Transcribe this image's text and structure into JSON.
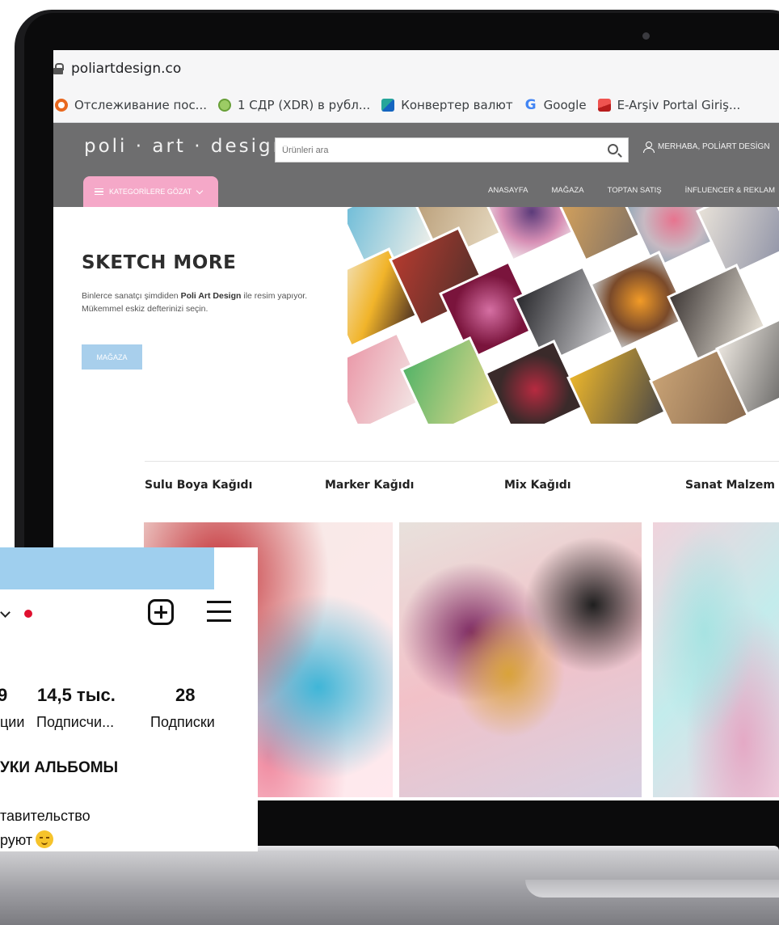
{
  "browser": {
    "url": "poliartdesign.co",
    "bookmarks": [
      {
        "label": "Отслеживание пос...",
        "icon": "tracking-icon",
        "color": "#e9681f"
      },
      {
        "label": "1 СДР (XDR) в рубл...",
        "icon": "xdr-icon",
        "color": "#7cb342"
      },
      {
        "label": "Конвертер валют",
        "icon": "currency-icon",
        "color": "#1e88a8"
      },
      {
        "label": "Google",
        "icon": "google-icon",
        "color": "#4285f4"
      },
      {
        "label": "E-Arşiv Portal Giriş...",
        "icon": "earsiv-icon",
        "color": "#c62828"
      }
    ]
  },
  "site": {
    "logo": "poli · art · design",
    "search_placeholder": "Ürünleri ara",
    "user_label": "MERHABA, POLİART DESİGN",
    "categories_button": "KATEGORİLERE GÖZAT",
    "nav": [
      "ANASAYFA",
      "MAĞAZA",
      "TOPTAN SATIŞ",
      "İNFLUENCER & REKLAM"
    ],
    "hero": {
      "title": "SKETCH MORE",
      "line1_start": "Binlerce sanatçı şimdiden ",
      "line1_bold": "Poli Art Design",
      "line1_end": " ile resim yapıyor.",
      "line2": "Mükemmel eskiz defterinizi seçin.",
      "button": "MAĞAZA"
    },
    "categories": [
      "Sulu Boya Kağıdı",
      "Marker Kağıdı",
      "Mix Kağıdı",
      "Sanat Malzem"
    ],
    "colors": {
      "header": "#6e6e6f",
      "pink": "#f5a8c8",
      "blue": "#a8cfec"
    }
  },
  "instagram": {
    "stats": [
      {
        "value": "9",
        "label": "ции"
      },
      {
        "value": "14,5 тыс.",
        "label": "Подписчи..."
      },
      {
        "value": "28",
        "label": "Подписки"
      }
    ],
    "line1": "УКИ АЛЬБОМЫ",
    "line2": "тавительство",
    "line3": "руют"
  }
}
